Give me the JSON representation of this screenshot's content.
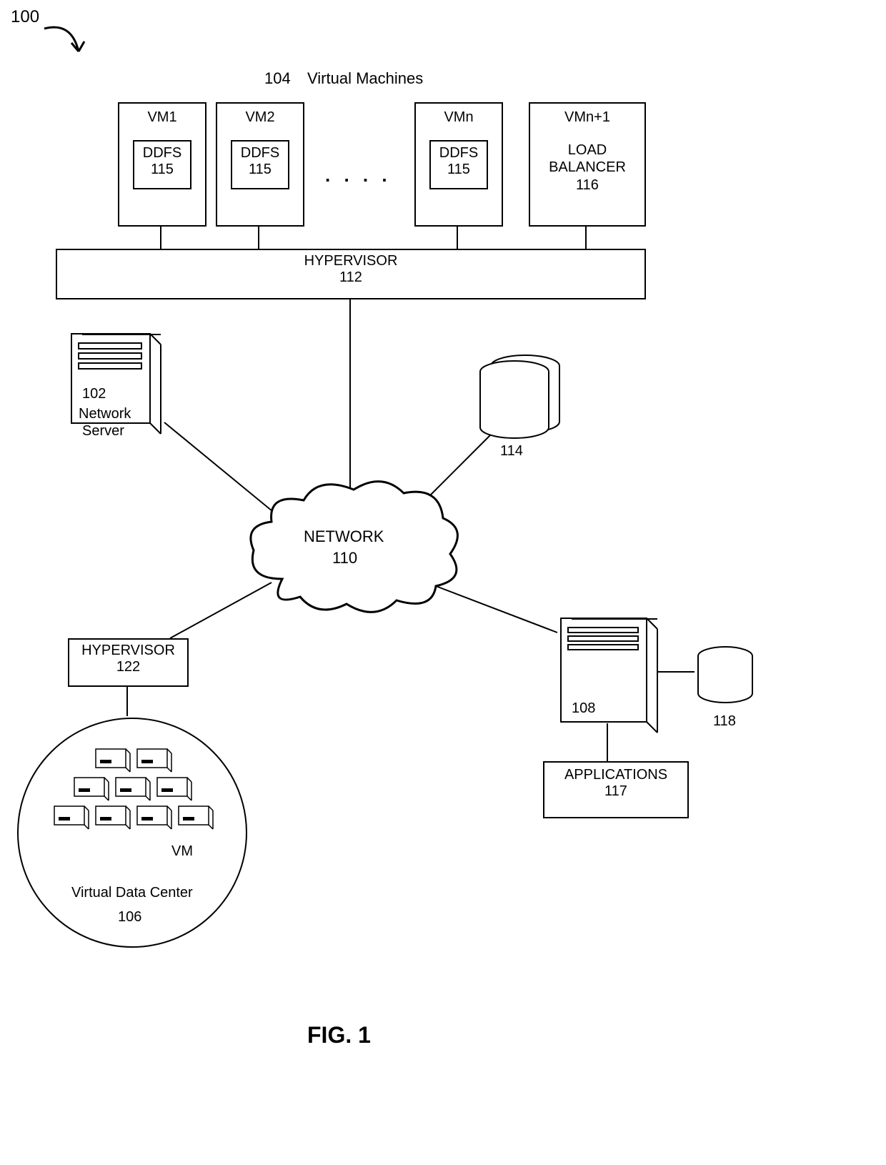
{
  "figure": {
    "diagram_number": "100",
    "top_row_title_num": "104",
    "top_row_title_text": "Virtual Machines",
    "caption": "FIG.  1"
  },
  "vms": {
    "vm1": {
      "title": "VM1",
      "inner_label": "DDFS",
      "inner_num": "115"
    },
    "vm2": {
      "title": "VM2",
      "inner_label": "DDFS",
      "inner_num": "115"
    },
    "vmn": {
      "title": "VMn",
      "inner_label": "DDFS",
      "inner_num": "115"
    },
    "vmn1": {
      "title": "VMn+1",
      "inner_label": "LOAD\nBALANCER",
      "inner_num": "116"
    },
    "ellipsis": ". . . ."
  },
  "hypervisor_top": {
    "label": "HYPERVISOR",
    "num": "112"
  },
  "network_server": {
    "num": "102",
    "label_line1": "Network",
    "label_line2": "Server"
  },
  "storage_right": {
    "num": "114"
  },
  "network_cloud": {
    "label": "NETWORK",
    "num": "110"
  },
  "hypervisor_left": {
    "label": "HYPERVISOR",
    "num": "122"
  },
  "vdc": {
    "vm_label": "VM",
    "title": "Virtual Data Center",
    "num": "106"
  },
  "server_right": {
    "num": "108",
    "db_num": "118"
  },
  "applications": {
    "label": "APPLICATIONS",
    "num": "117"
  }
}
